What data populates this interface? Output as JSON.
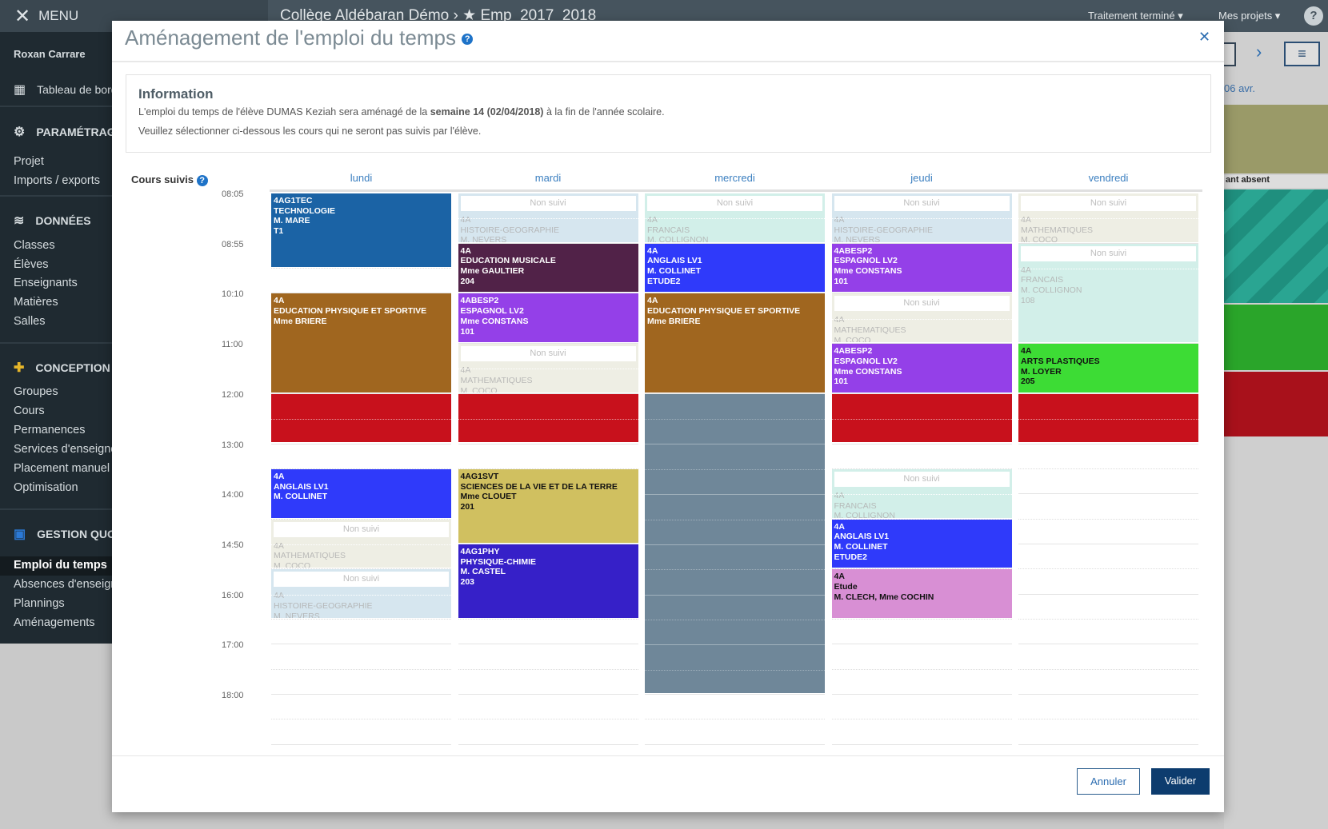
{
  "topbar": {
    "menu_label": "MENU",
    "breadcrumb": "Collège Aldébaran Démo › ★ Emp_2017_2018",
    "status": "Traitement terminé ▾",
    "projects": "Mes projets ▾",
    "help": "?"
  },
  "sidebar": {
    "user": "Roxan Carrare",
    "dashboard": "Tableau de bord",
    "sections": [
      {
        "title": "PARAMÉTRAGE",
        "icon": "gear-icon",
        "items": [
          "Projet",
          "Imports / exports"
        ]
      },
      {
        "title": "DONNÉES",
        "icon": "database-icon",
        "items": [
          "Classes",
          "Élèves",
          "Enseignants",
          "Matières",
          "Salles"
        ]
      },
      {
        "title": "CONCEPTION",
        "icon": "puzzle-icon",
        "items": [
          "Groupes",
          "Cours",
          "Permanences",
          "Services d'enseignement",
          "Placement manuel",
          "Optimisation"
        ]
      },
      {
        "title": "GESTION QUOTIDIENNE",
        "icon": "calendar-icon",
        "items": [
          "Emploi du temps",
          "Absences d'enseignants",
          "Plannings",
          "Aménagements"
        ]
      }
    ],
    "active_item": "Emploi du temps"
  },
  "background": {
    "date_label": "06 avr.",
    "absent_label": "ant absent"
  },
  "modal": {
    "title": "Aménagement de l'emploi du temps",
    "info_title": "Information",
    "info_line1_pre": "L'emploi du temps de l'élève DUMAS Keziah sera aménagé de la ",
    "info_line1_bold": "semaine 14 (02/04/2018)",
    "info_line1_post": " à la fin de l'année scolaire.",
    "info_line2": "Veuillez sélectionner ci-dessous les cours qui ne seront pas suivis par l'élève.",
    "cours_suivis": "Cours suivis",
    "cancel": "Annuler",
    "validate": "Valider"
  },
  "timetable": {
    "non_suivi_label": "Non suivi",
    "times": [
      "08:05",
      "08:55",
      "10:10",
      "11:00",
      "12:00",
      "13:00",
      "14:00",
      "14:50",
      "16:00",
      "17:00",
      "18:00"
    ],
    "colors": {
      "techno": "#1b63a5",
      "eps": "#a0661f",
      "lunch": "#c8111c",
      "musique": "#512248",
      "espagnol": "#9440e8",
      "anglais": "#2f3afa",
      "svt": "#d0c060",
      "physique": "#3620c8",
      "arts": "#3ddc35",
      "etude": "#d88fd4",
      "closed": "#6f8799",
      "hist_faded": "#d6e6ef",
      "fr_faded": "#d2efe9",
      "math_faded": "#eeeee4"
    },
    "days": [
      {
        "name": "lundi",
        "events": [
          {
            "period_start": 0,
            "period_length": 1.5,
            "color": "techno",
            "lines": [
              "4AG1TEC",
              "TECHNOLOGIE",
              "M. MARE",
              "T1"
            ]
          },
          {
            "period_start": 2,
            "period_length": 2,
            "color": "eps",
            "lines": [
              "4A",
              "EDUCATION PHYSIQUE ET SPORTIVE",
              "Mme BRIERE"
            ]
          },
          {
            "period_start": 4,
            "period_length": 1,
            "color": "lunch",
            "lines": []
          },
          {
            "period_start": 5.5,
            "period_length": 1,
            "color": "anglais",
            "lines": [
              "4A",
              "ANGLAIS LV1",
              "M. COLLINET"
            ]
          },
          {
            "period_start": 6.5,
            "period_length": 1,
            "color": "math_faded",
            "followed": false,
            "lines": [
              "4A",
              "MATHEMATIQUES",
              "M. COCO"
            ]
          },
          {
            "period_start": 7.5,
            "period_length": 1,
            "color": "hist_faded",
            "followed": false,
            "lines": [
              "4A",
              "HISTOIRE-GEOGRAPHIE",
              "M. NEVERS"
            ]
          }
        ]
      },
      {
        "name": "mardi",
        "events": [
          {
            "period_start": 0,
            "period_length": 1,
            "color": "hist_faded",
            "followed": false,
            "lines": [
              "4A",
              "HISTOIRE-GEOGRAPHIE",
              "M. NEVERS"
            ]
          },
          {
            "period_start": 1,
            "period_length": 1,
            "color": "musique",
            "lines": [
              "4A",
              "EDUCATION MUSICALE",
              "Mme GAULTIER",
              "204"
            ]
          },
          {
            "period_start": 2,
            "period_length": 1,
            "color": "espagnol",
            "lines": [
              "4ABESP2",
              "ESPAGNOL LV2",
              "Mme CONSTANS",
              "101"
            ]
          },
          {
            "period_start": 3,
            "period_length": 1,
            "color": "math_faded",
            "followed": false,
            "lines": [
              "4A",
              "MATHEMATIQUES",
              "M. COCO"
            ]
          },
          {
            "period_start": 4,
            "period_length": 1,
            "color": "lunch",
            "lines": []
          },
          {
            "period_start": 5.5,
            "period_length": 1.5,
            "color": "svt",
            "dark": true,
            "lines": [
              "4AG1SVT",
              "SCIENCES DE LA VIE ET DE LA TERRE",
              "Mme CLOUET",
              "201"
            ]
          },
          {
            "period_start": 7,
            "period_length": 1.5,
            "color": "physique",
            "lines": [
              "4AG1PHY",
              "PHYSIQUE-CHIMIE",
              "M. CASTEL",
              "203"
            ]
          }
        ]
      },
      {
        "name": "mercredi",
        "events": [
          {
            "period_start": 0,
            "period_length": 1,
            "color": "fr_faded",
            "followed": false,
            "lines": [
              "4A",
              "FRANCAIS",
              "M. COLLIGNON"
            ]
          },
          {
            "period_start": 1,
            "period_length": 1,
            "color": "anglais",
            "lines": [
              "4A",
              "ANGLAIS LV1",
              "M. COLLINET",
              "ETUDE2"
            ]
          },
          {
            "period_start": 2,
            "period_length": 2,
            "color": "eps",
            "lines": [
              "4A",
              "EDUCATION PHYSIQUE ET SPORTIVE",
              "Mme BRIERE"
            ]
          },
          {
            "period_start": 4,
            "period_length": 6,
            "color": "closed",
            "lines": []
          }
        ]
      },
      {
        "name": "jeudi",
        "events": [
          {
            "period_start": 0,
            "period_length": 1,
            "color": "hist_faded",
            "followed": false,
            "lines": [
              "4A",
              "HISTOIRE-GEOGRAPHIE",
              "M. NEVERS"
            ]
          },
          {
            "period_start": 1,
            "period_length": 1,
            "color": "espagnol",
            "lines": [
              "4ABESP2",
              "ESPAGNOL LV2",
              "Mme CONSTANS",
              "101"
            ]
          },
          {
            "period_start": 2,
            "period_length": 1,
            "color": "math_faded",
            "followed": false,
            "lines": [
              "4A",
              "MATHEMATIQUES",
              "M. COCO"
            ]
          },
          {
            "period_start": 3,
            "period_length": 1,
            "color": "espagnol",
            "lines": [
              "4ABESP2",
              "ESPAGNOL LV2",
              "Mme CONSTANS",
              "101"
            ]
          },
          {
            "period_start": 4,
            "period_length": 1,
            "color": "lunch",
            "lines": []
          },
          {
            "period_start": 5.5,
            "period_length": 1,
            "color": "fr_faded",
            "followed": false,
            "lines": [
              "4A",
              "FRANCAIS",
              "M. COLLIGNON"
            ]
          },
          {
            "period_start": 6.5,
            "period_length": 1,
            "color": "anglais",
            "lines": [
              "4A",
              "ANGLAIS LV1",
              "M. COLLINET",
              "ETUDE2"
            ]
          },
          {
            "period_start": 7.5,
            "period_length": 1,
            "color": "etude",
            "dark": true,
            "lines": [
              "4A",
              "Etude",
              "M. CLECH, Mme COCHIN"
            ]
          }
        ]
      },
      {
        "name": "vendredi",
        "events": [
          {
            "period_start": 0,
            "period_length": 1,
            "color": "math_faded",
            "followed": false,
            "lines": [
              "4A",
              "MATHEMATIQUES",
              "M. COCO"
            ]
          },
          {
            "period_start": 1,
            "period_length": 2,
            "color": "fr_faded",
            "followed": false,
            "lines": [
              "4A",
              "FRANCAIS",
              "M. COLLIGNON",
              "108"
            ]
          },
          {
            "period_start": 3,
            "period_length": 1,
            "color": "arts",
            "dark": true,
            "lines": [
              "4A",
              "ARTS PLASTIQUES",
              "M. LOYER",
              "205"
            ]
          },
          {
            "period_start": 4,
            "period_length": 1,
            "color": "lunch",
            "lines": []
          }
        ]
      }
    ]
  }
}
